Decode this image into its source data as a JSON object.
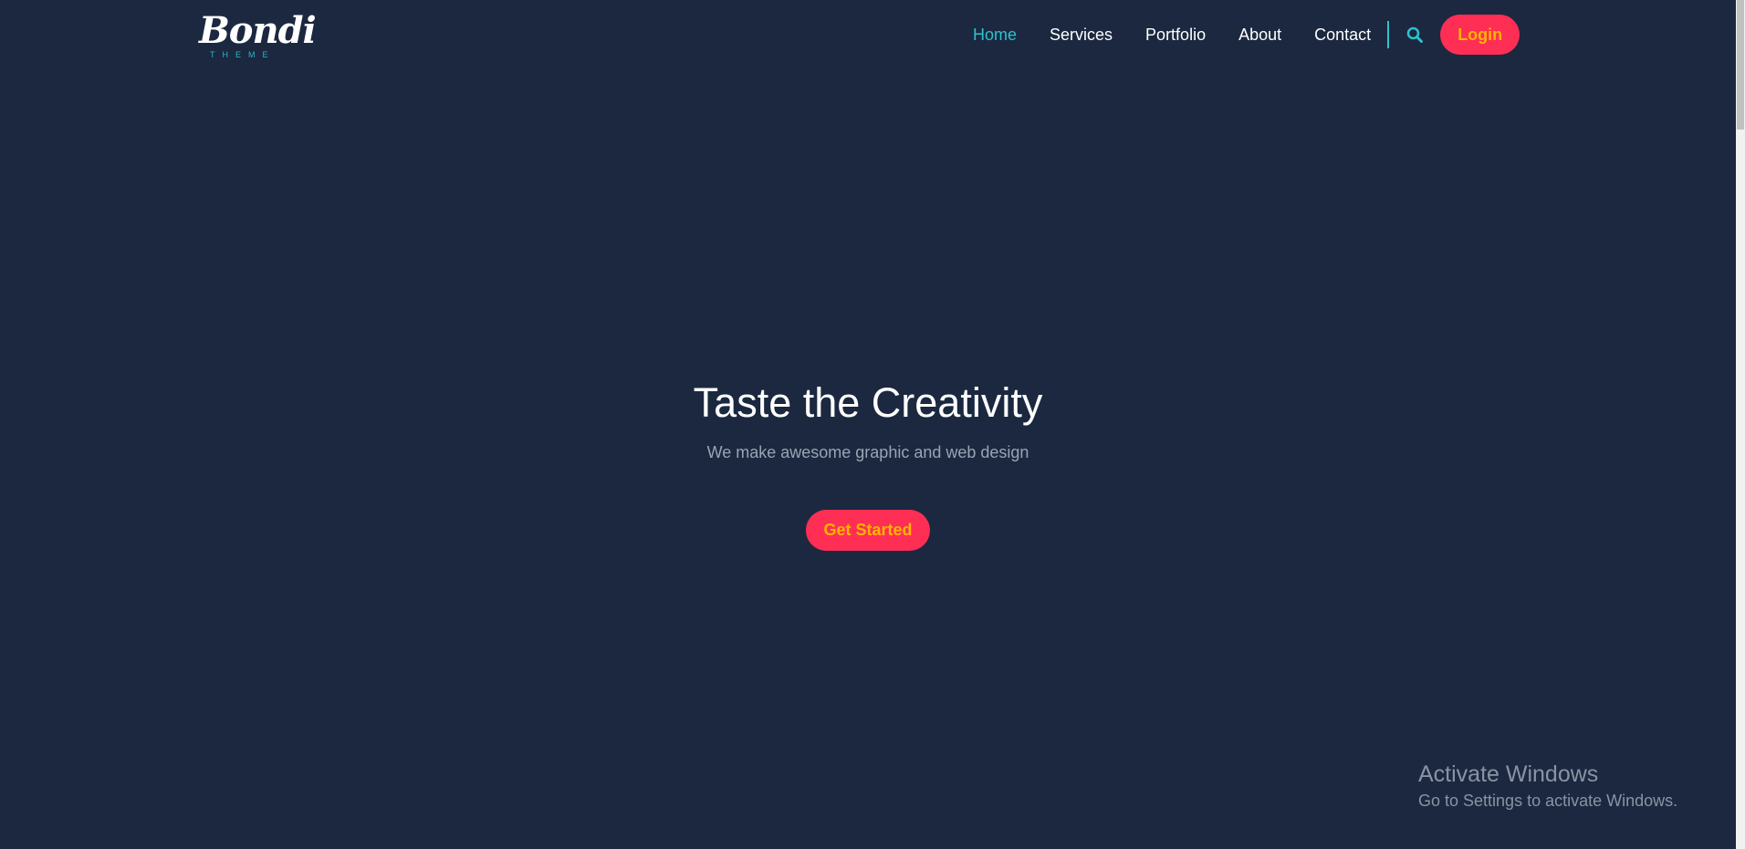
{
  "brand": {
    "name": "Bondi",
    "tagline": "THEME"
  },
  "nav": {
    "items": [
      {
        "label": "Home",
        "active": true
      },
      {
        "label": "Services",
        "active": false
      },
      {
        "label": "Portfolio",
        "active": false
      },
      {
        "label": "About",
        "active": false
      },
      {
        "label": "Contact",
        "active": false
      }
    ],
    "search_icon": "search-icon",
    "login_label": "Login"
  },
  "hero": {
    "title": "Taste the Creativity",
    "subtitle": "We make awesome graphic and web design",
    "cta_label": "Get Started"
  },
  "watermark": {
    "title": "Activate Windows",
    "subtitle": "Go to Settings to activate Windows."
  },
  "colors": {
    "background": "#1b2840",
    "accent_teal": "#2ec1cc",
    "button_red": "#ff2e54",
    "button_text_yellow": "#ffb400"
  }
}
